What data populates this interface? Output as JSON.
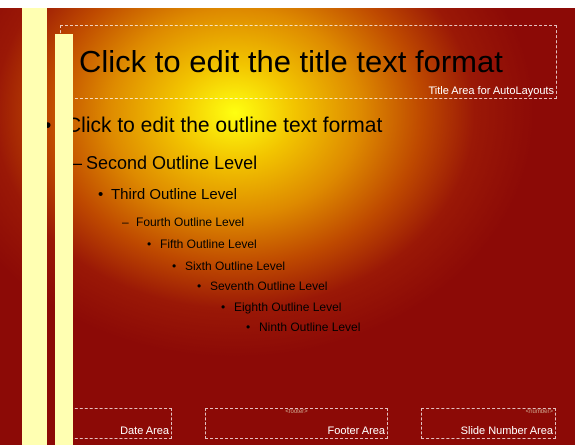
{
  "slide": {
    "title": "Click to edit the title text format",
    "title_area_label": "Title Area for AutoLayouts",
    "outline": [
      {
        "marker": "•",
        "text": "Click to edit the outline text format"
      },
      {
        "marker": "–",
        "text": "Second Outline Level"
      },
      {
        "marker": "•",
        "text": "Third Outline Level"
      },
      {
        "marker": "–",
        "text": "Fourth Outline Level"
      },
      {
        "marker": "•",
        "text": "Fifth Outline Level"
      },
      {
        "marker": "•",
        "text": "Sixth Outline Level"
      },
      {
        "marker": "•",
        "text": "Seventh Outline Level"
      },
      {
        "marker": "•",
        "text": "Eighth Outline Level"
      },
      {
        "marker": "•",
        "text": "Ninth Outline Level"
      }
    ],
    "date_area_label": "Date Area",
    "footer_area_label": "Footer Area",
    "slide_number_area_label": "Slide Number Area",
    "footer_placeholder": "<footer>",
    "slide_number_placeholder": "<number>"
  },
  "colors": {
    "center": "#ffff10",
    "edge": "#8c0a06",
    "sidebar": "#ffffb2"
  }
}
